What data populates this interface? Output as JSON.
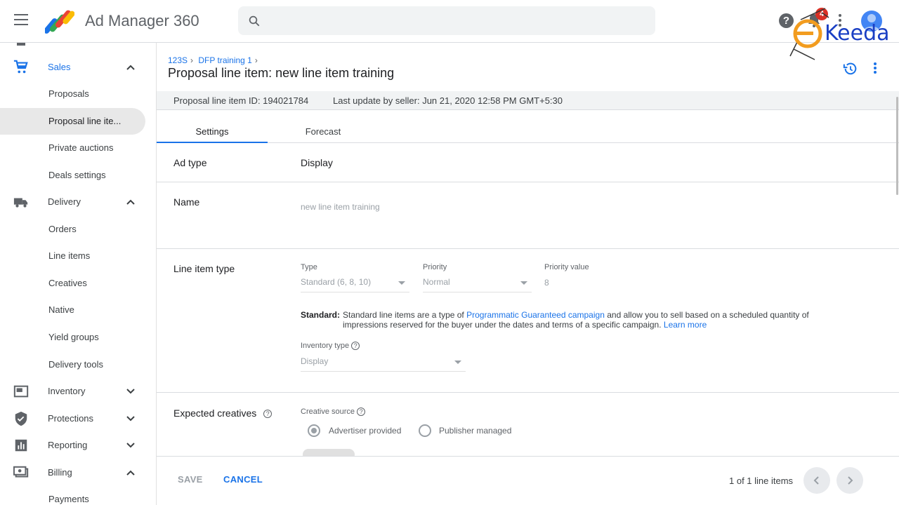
{
  "topbar": {
    "app_title": "Ad Manager 360",
    "search_placeholder": "",
    "notification_count": "4",
    "watermark": "Keeda"
  },
  "sidebar": {
    "items": [
      {
        "label": "Sales",
        "type": "section",
        "icon": "cart-icon",
        "expanded": true
      },
      {
        "label": "Proposals",
        "type": "child"
      },
      {
        "label": "Proposal line ite...",
        "type": "child",
        "selected": true
      },
      {
        "label": "Private auctions",
        "type": "child"
      },
      {
        "label": "Deals settings",
        "type": "child"
      },
      {
        "label": "Delivery",
        "type": "section",
        "icon": "truck-icon",
        "expanded": true
      },
      {
        "label": "Orders",
        "type": "child"
      },
      {
        "label": "Line items",
        "type": "child"
      },
      {
        "label": "Creatives",
        "type": "child"
      },
      {
        "label": "Native",
        "type": "child"
      },
      {
        "label": "Yield groups",
        "type": "child"
      },
      {
        "label": "Delivery tools",
        "type": "child"
      },
      {
        "label": "Inventory",
        "type": "section",
        "icon": "inventory-icon",
        "expanded": false
      },
      {
        "label": "Protections",
        "type": "section",
        "icon": "shield-icon",
        "expanded": false
      },
      {
        "label": "Reporting",
        "type": "section",
        "icon": "chart-icon",
        "expanded": false
      },
      {
        "label": "Billing",
        "type": "section",
        "icon": "billing-icon",
        "expanded": true
      },
      {
        "label": "Payments",
        "type": "child"
      }
    ]
  },
  "main": {
    "breadcrumbs": [
      "123S",
      "DFP training 1"
    ],
    "title": "Proposal line item: new line item training",
    "info": {
      "id": "Proposal line item ID: 194021784",
      "last_update": "Last update by seller: Jun 21, 2020 12:58 PM GMT+5:30"
    },
    "tabs": [
      {
        "label": "Settings",
        "active": true
      },
      {
        "label": "Forecast",
        "active": false
      }
    ],
    "ad_type": {
      "label": "Ad type",
      "value": "Display"
    },
    "name": {
      "label": "Name",
      "value": "new line item training"
    },
    "line_item_type": {
      "label": "Line item type",
      "type_label": "Type",
      "type_value": "Standard (6, 8, 10)",
      "priority_label": "Priority",
      "priority_value": "Normal",
      "priority_value_label": "Priority value",
      "priority_value_value": "8",
      "desc_bold": "Standard:",
      "desc_1": "Standard line items are a type of",
      "desc_link": "Programmatic Guaranteed campaign",
      "desc_2": "and allow you to sell based on a scheduled quantity of impressions reserved for the buyer under the dates and terms of a specific campaign.",
      "learn_more": "Learn more",
      "inventory_type_label": "Inventory type",
      "inventory_type_value": "Display"
    },
    "expected_creatives": {
      "label": "Expected creatives",
      "source_label": "Creative source",
      "option_1": "Advertiser provided",
      "option_2": "Publisher managed",
      "selected": "Advertiser provided"
    }
  },
  "footer": {
    "save": "SAVE",
    "cancel": "CANCEL",
    "pager": "1 of 1 line items"
  }
}
